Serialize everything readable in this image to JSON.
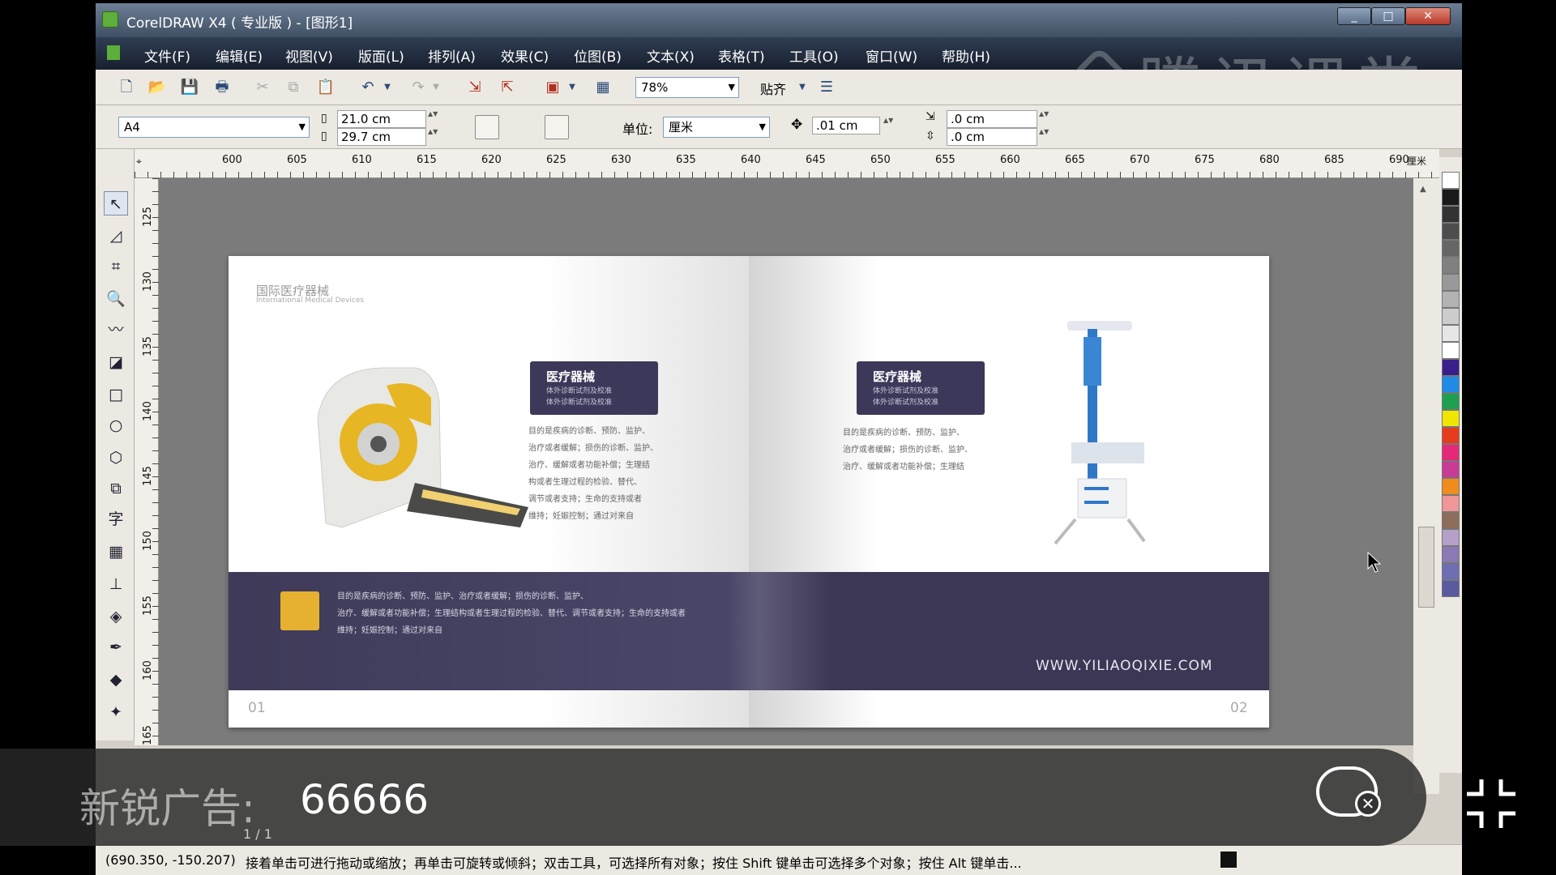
{
  "window": {
    "title": "CorelDRAW X4 ( 专业版 ) - [图形1]",
    "min": "_",
    "max": "□",
    "close": "✕"
  },
  "menu": [
    "文件(F)",
    "编辑(E)",
    "视图(V)",
    "版面(L)",
    "排列(A)",
    "效果(C)",
    "位图(B)",
    "文本(X)",
    "表格(T)",
    "工具(O)",
    "窗口(W)",
    "帮助(H)"
  ],
  "watermark": "腾讯课堂",
  "toolbar": {
    "zoom": "78%",
    "snap_label": "贴齐"
  },
  "properties": {
    "page_size": "A4",
    "width": "21.0 cm",
    "height": "29.7 cm",
    "unit_label": "单位:",
    "unit": "厘米",
    "nudge": ".01 cm",
    "dup_x": ".0 cm",
    "dup_y": ".0 cm"
  },
  "ruler": {
    "h": [
      "600",
      "605",
      "610",
      "615",
      "620",
      "625",
      "630",
      "635",
      "640",
      "645",
      "650",
      "655",
      "660",
      "665",
      "670",
      "675",
      "680",
      "685",
      "690"
    ],
    "h_unit": "厘米",
    "v": [
      "125",
      "130",
      "135",
      "140",
      "145",
      "150",
      "155",
      "160",
      "165"
    ]
  },
  "document": {
    "brand_cn": "国际医疗器械",
    "brand_en": "International Medical Devices",
    "tag_title": "医疗器械",
    "tag_sub": "体外诊断试剂及校准\n体外诊断试剂及校准",
    "left_body": "目的是疾病的诊断、预防、监护、\n治疗或者缓解；损伤的诊断、监护、\n治疗、缓解或者功能补偿；生理结\n构或者生理过程的检验、替代、\n调节或者支持；生命的支持或者\n维持；妊娠控制；通过对来自",
    "right_body": "目的是疾病的诊断、预防、监护、\n治疗或者缓解；损伤的诊断、监护、\n治疗、缓解或者功能补偿；生理结",
    "band_text": "目的是疾病的诊断、预防、监护、治疗或者缓解；损伤的诊断、监护、\n治疗、缓解或者功能补偿；生理结构或者生理过程的检验、替代、调节或者支持；生命的支持或者\n维持；妊娠控制；通过对来自",
    "url": "WWW.YILIAOQIXIE.COM",
    "page_left": "01",
    "page_right": "02"
  },
  "pagenav": {
    "count": "1 / 1"
  },
  "status": {
    "coords": "(690.350, -150.207)",
    "hint": "接着单击可进行拖动或缩放；再单击可旋转或倾斜；双击工具，可选择所有对象；按住 Shift 键单击可选择多个对象；按住 Alt 键单击..."
  },
  "overlay": {
    "ad_label": "新锐广告:",
    "ad_number": "66666"
  },
  "palette": [
    "#ffffff",
    "#1a1a1a",
    "#333333",
    "#4d4d4d",
    "#666666",
    "#808080",
    "#999999",
    "#b3b3b3",
    "#cccccc",
    "#e6e6e6",
    "#ffffff",
    "#3a1e8c",
    "#1e8ce6",
    "#1ea050",
    "#f0e600",
    "#e63c1e",
    "#e6287a",
    "#c83c96",
    "#f08c1e",
    "#f09696",
    "#8c6e5a",
    "#b4a0c8",
    "#8c78b4",
    "#6e6eb4",
    "#5a5aa0"
  ]
}
